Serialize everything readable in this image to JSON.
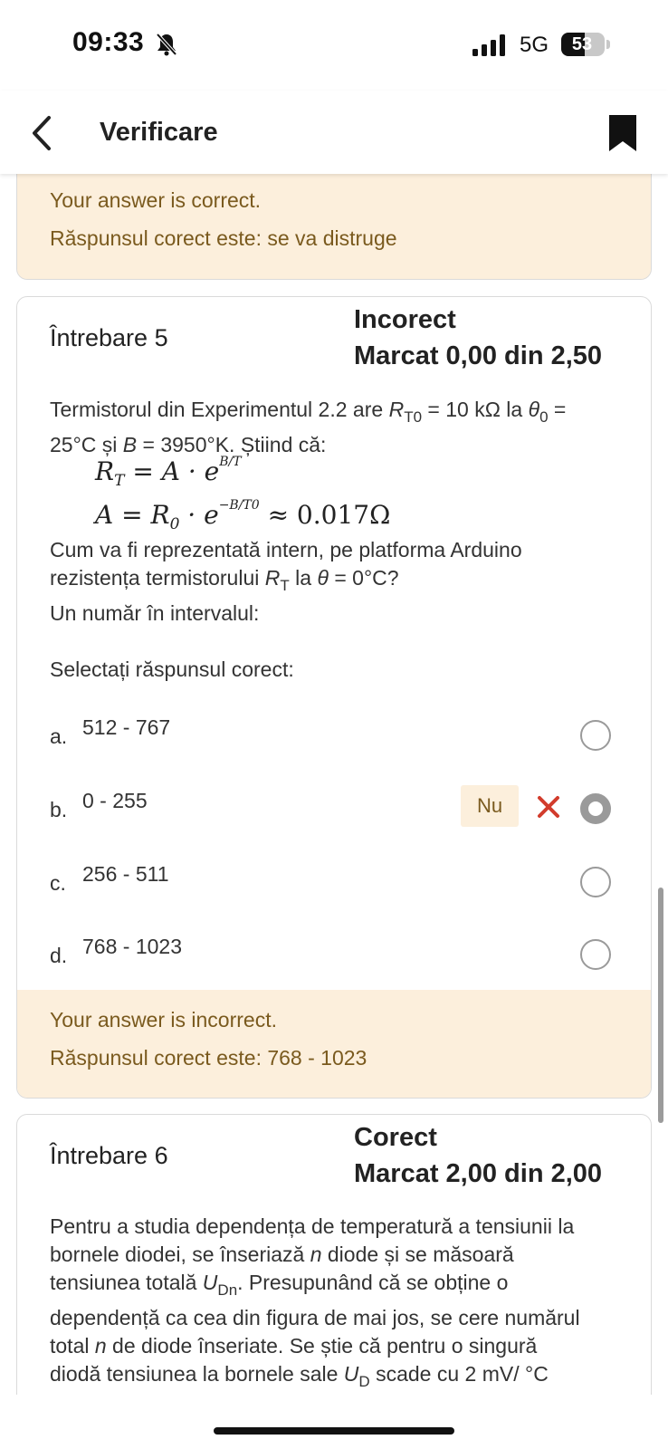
{
  "status_bar": {
    "time": "09:33",
    "network": "5G",
    "battery": "53",
    "battery_level_percent": 53
  },
  "app_bar": {
    "title": "Verificare"
  },
  "prev_feedback": {
    "line1": "Your answer is correct.",
    "line2": "Răspunsul corect este: se va distruge"
  },
  "q5": {
    "title": "Întrebare 5",
    "state": "Incorect",
    "grade": "Marcat 0,00 din 2,50",
    "text": {
      "p1_a": "Termistorul din Experimentul 2.2 are ",
      "R": "R",
      "T0": "T0",
      "p1_b": " = 10 kΩ la ",
      "theta": "θ",
      "zero": "0",
      "p1_c": " =",
      "p1_d": "25°C și ",
      "B": "B",
      "p1_e": " = 3950°K. Știind că:",
      "p2_a": "Cum va fi reprezentată intern, pe platforma Arduino",
      "p2_b": "rezistența termistorului ",
      "T": "T",
      "p2_c": " la ",
      "p2_d": " = 0°C?",
      "p3": "Un număr în intervalul:"
    },
    "formula1": {
      "lhs": "R",
      "lhs_sub": "T",
      "eq": " = A · e",
      "exp": "B/T"
    },
    "formula2": {
      "lhs": "A = R",
      "lhs_sub": "0",
      "mid": " · e",
      "exp": "−B/T0",
      "approx": " ≈ 0.017Ω"
    },
    "prompt": "Selectați răspunsul corect:",
    "options": [
      {
        "letter": "a.",
        "text": "512 - 767",
        "selected": false
      },
      {
        "letter": "b.",
        "text": "0 - 255",
        "selected": true
      },
      {
        "letter": "c.",
        "text": "256 - 511",
        "selected": false
      },
      {
        "letter": "d.",
        "text": "768 - 1023",
        "selected": false
      }
    ],
    "selected_badge": "Nu",
    "feedback": {
      "line1": "Your answer is incorrect.",
      "line2": "Răspunsul corect este: 768 - 1023"
    }
  },
  "q6": {
    "title": "Întrebare 6",
    "state": "Corect",
    "grade": "Marcat 2,00 din 2,00",
    "text": {
      "l1": "Pentru a studia dependența de temperatură a tensiunii la",
      "l2_a": "bornele diodei, se înseriază ",
      "n": "n",
      "l2_b": " diode și se măsoară",
      "l3_a": "tensiunea totală ",
      "U": "U",
      "Dn": "Dn",
      "l3_b": ". Presupunând că se obține o",
      "l4": "dependență ca cea din figura de mai jos, se cere numărul",
      "l5_a": "total ",
      "l5_b": " de diode înseriate. Se știe că pentru o singură",
      "l6_a": "diodă tensiunea la bornele sale ",
      "D": "D",
      "l6_b": " scade cu 2 mV/ °C"
    }
  },
  "colors": {
    "feedback_bg": "#fcefdc",
    "feedback_text": "#7a5a1e",
    "wrong": "#d23c2c",
    "radio": "#9a9a9a"
  },
  "icons": [
    "bell-slash-icon",
    "signal-icon",
    "battery-icon",
    "back-chevron-icon",
    "bookmark-icon",
    "wrong-cross-icon"
  ]
}
